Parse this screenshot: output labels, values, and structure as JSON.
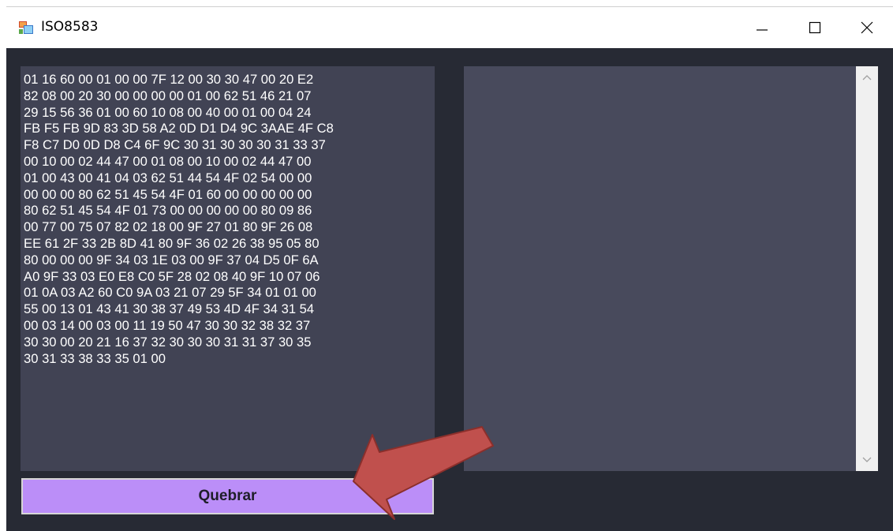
{
  "window": {
    "title": "ISO8583",
    "icon": "winforms-app-icon",
    "controls": [
      "minimize-icon",
      "maximize-icon",
      "close-icon"
    ]
  },
  "input": {
    "text": "01 16 60 00 01 00 00 7F 12 00 30 30 47 00 20 E2\n82 08 00 20 30 00 00 00 00 01 00 62 51 46 21 07\n29 15 56 36 01 00 60 10 08 00 40 00 01 00 04 24\nFB F5 FB 9D 83 3D 58 A2 0D D1 D4 9C 3AAE 4F C8\nF8 C7 D0 0D D8 C4 6F 9C 30 31 30 30 30 31 33 37\n00 10 00 02 44 47 00 01 08 00 10 00 02 44 47 00\n01 00 43 00 41 04 03 62 51 44 54 4F 02 54 00 00\n00 00 00 80 62 51 45 54 4F 01 60 00 00 00 00 00\n80 62 51 45 54 4F 01 73 00 00 00 00 00 80 09 86\n00 77 00 75 07 82 02 18 00 9F 27 01 80 9F 26 08\nEE 61 2F 33 2B 8D 41 80 9F 36 02 26 38 95 05 80\n80 00 00 00 9F 34 03 1E 03 00 9F 37 04 D5 0F 6A\nA0 9F 33 03 E0 E8 C0 5F 28 02 08 40 9F 10 07 06\n01 0A 03 A2 60 C0 9A 03 21 07 29 5F 34 01 01 00\n55 00 13 01 43 41 30 38 37 49 53 4D 4F 34 31 54\n00 03 14 00 03 00 11 19 50 47 30 30 32 38 32 37\n30 30 00 20 21 16 37 32 30 30 30 31 31 37 30 35\n30 31 33 38 33 35 01 00"
  },
  "output": {
    "text": ""
  },
  "button": {
    "label": "Quebrar",
    "color": "#bb8ef8"
  },
  "annotation": {
    "icon": "red-arrow-icon",
    "color": "#c0504d"
  },
  "colors": {
    "client_bg": "#272a34",
    "input_bg": "#414354",
    "output_bg": "#484a5c"
  }
}
